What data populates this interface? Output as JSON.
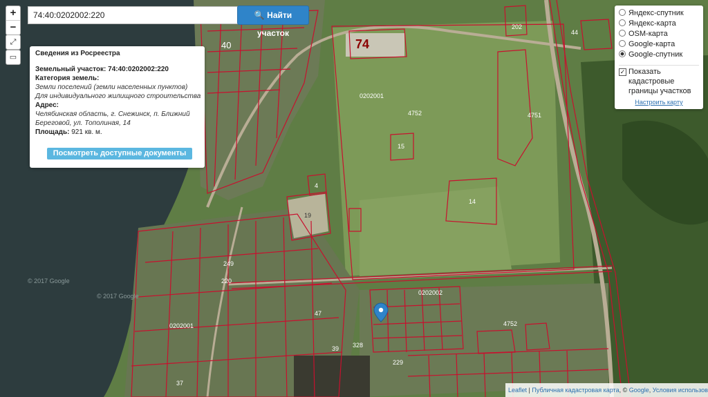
{
  "search": {
    "value": "74:40:0202002:220",
    "button_label": "Найти участок"
  },
  "zoom": {
    "in_label": "+",
    "out_label": "−"
  },
  "tools": {
    "measure_label": "⤢",
    "small_label": "▭"
  },
  "info_panel": {
    "title": "Сведения из Росреестра",
    "parcel_label": "Земельный участок:",
    "parcel_value": "74:40:0202002:220",
    "category_label": "Категория земель:",
    "category_value_1": "Земли поселений (земли населенных пунктов)",
    "category_value_2": "Для индивидуального жилищного строительства",
    "address_label": "Адрес:",
    "address_value_1": "Челябинская область, г. Снежинск, п. Ближний",
    "address_value_2": "Береговой, ул. Тополиная, 14",
    "area_label": "Площадь:",
    "area_value": "921 кв. м.",
    "docs_button": "Посмотреть доступные документы"
  },
  "layers": {
    "options": [
      "Яндекс-спутник",
      "Яндекс-карта",
      "OSM-карта",
      "Google-карта",
      "Google-спутник"
    ],
    "selected_index": 4,
    "cadastral_checked": true,
    "cadastral_label": "Показать кадастровые границы участков",
    "configure_link": "Настроить карту"
  },
  "map_labels": {
    "block_top": "0202001",
    "block_mid": "0202002",
    "block_left": "0202001",
    "region_code": "74",
    "parcel_40": "40",
    "parcel_4752_a": "4752",
    "parcel_4751": "4751",
    "parcel_4752_b": "4752",
    "parcel_15": "15",
    "parcel_14": "14",
    "parcel_19": "19",
    "parcel_4": "4",
    "parcel_44": "44",
    "parcel_202": "202",
    "parcel_37": "37",
    "parcel_328": "328",
    "parcel_229": "229",
    "parcel_39": "39",
    "parcel_47": "47",
    "parcel_249": "249",
    "parcel_220": "220",
    "watermark_google_1": "© 2017 Google",
    "watermark_google_2": "© 2017 Google"
  },
  "attribution": {
    "leaflet": "Leaflet",
    "sep": " | ",
    "pkk": "Публичная кадастровая карта",
    "google_sep": ", © ",
    "google": "Google",
    "terms_sep": ", ",
    "terms": "Условия использования"
  },
  "colors": {
    "water": "#2b3b3c",
    "field": "#6f8c4c",
    "forest": "#3f5d2d",
    "cadastral": "#c8102e",
    "road": "#b9ad95"
  }
}
